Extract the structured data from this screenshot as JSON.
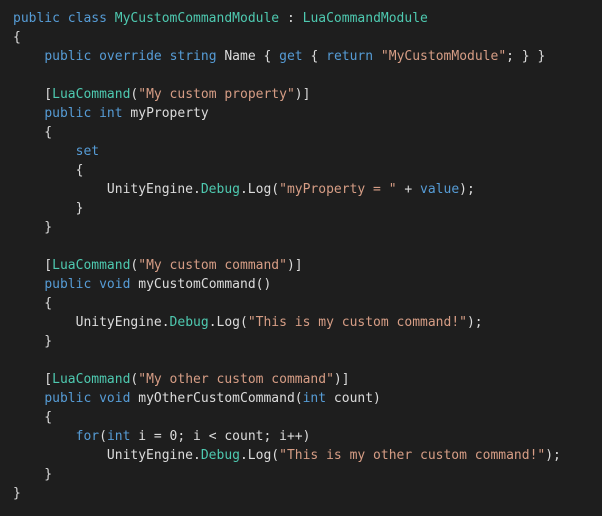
{
  "colors": {
    "background": "#1e1e1e",
    "plain": "#dcdcdc",
    "keyword": "#569cd6",
    "type": "#4ec9b0",
    "string": "#d69d85"
  },
  "code_lines": [
    [
      {
        "t": "public",
        "c": "kw"
      },
      {
        "t": " ",
        "c": "pl"
      },
      {
        "t": "class",
        "c": "kw"
      },
      {
        "t": " ",
        "c": "pl"
      },
      {
        "t": "MyCustomCommandModule",
        "c": "ty"
      },
      {
        "t": " : ",
        "c": "pl"
      },
      {
        "t": "LuaCommandModule",
        "c": "ty"
      }
    ],
    [
      {
        "t": "{",
        "c": "pl"
      }
    ],
    [
      {
        "t": "    ",
        "c": "pl"
      },
      {
        "t": "public",
        "c": "kw"
      },
      {
        "t": " ",
        "c": "pl"
      },
      {
        "t": "override",
        "c": "kw"
      },
      {
        "t": " ",
        "c": "pl"
      },
      {
        "t": "string",
        "c": "kw"
      },
      {
        "t": " Name { ",
        "c": "pl"
      },
      {
        "t": "get",
        "c": "kw"
      },
      {
        "t": " { ",
        "c": "pl"
      },
      {
        "t": "return",
        "c": "kw"
      },
      {
        "t": " ",
        "c": "pl"
      },
      {
        "t": "\"MyCustomModule\"",
        "c": "st"
      },
      {
        "t": "; } }",
        "c": "pl"
      }
    ],
    [],
    [
      {
        "t": "    [",
        "c": "pl"
      },
      {
        "t": "LuaCommand",
        "c": "ty"
      },
      {
        "t": "(",
        "c": "pl"
      },
      {
        "t": "\"My custom property\"",
        "c": "st"
      },
      {
        "t": ")]",
        "c": "pl"
      }
    ],
    [
      {
        "t": "    ",
        "c": "pl"
      },
      {
        "t": "public",
        "c": "kw"
      },
      {
        "t": " ",
        "c": "pl"
      },
      {
        "t": "int",
        "c": "kw"
      },
      {
        "t": " myProperty",
        "c": "pl"
      }
    ],
    [
      {
        "t": "    {",
        "c": "pl"
      }
    ],
    [
      {
        "t": "        ",
        "c": "pl"
      },
      {
        "t": "set",
        "c": "kw"
      }
    ],
    [
      {
        "t": "        {",
        "c": "pl"
      }
    ],
    [
      {
        "t": "            UnityEngine.",
        "c": "pl"
      },
      {
        "t": "Debug",
        "c": "ty"
      },
      {
        "t": ".Log(",
        "c": "pl"
      },
      {
        "t": "\"myProperty = \"",
        "c": "st"
      },
      {
        "t": " + ",
        "c": "pl"
      },
      {
        "t": "value",
        "c": "kw"
      },
      {
        "t": ");",
        "c": "pl"
      }
    ],
    [
      {
        "t": "        }",
        "c": "pl"
      }
    ],
    [
      {
        "t": "    }",
        "c": "pl"
      }
    ],
    [],
    [
      {
        "t": "    [",
        "c": "pl"
      },
      {
        "t": "LuaCommand",
        "c": "ty"
      },
      {
        "t": "(",
        "c": "pl"
      },
      {
        "t": "\"My custom command\"",
        "c": "st"
      },
      {
        "t": ")]",
        "c": "pl"
      }
    ],
    [
      {
        "t": "    ",
        "c": "pl"
      },
      {
        "t": "public",
        "c": "kw"
      },
      {
        "t": " ",
        "c": "pl"
      },
      {
        "t": "void",
        "c": "kw"
      },
      {
        "t": " myCustomCommand()",
        "c": "pl"
      }
    ],
    [
      {
        "t": "    {",
        "c": "pl"
      }
    ],
    [
      {
        "t": "        UnityEngine.",
        "c": "pl"
      },
      {
        "t": "Debug",
        "c": "ty"
      },
      {
        "t": ".Log(",
        "c": "pl"
      },
      {
        "t": "\"This is my custom command!\"",
        "c": "st"
      },
      {
        "t": ");",
        "c": "pl"
      }
    ],
    [
      {
        "t": "    }",
        "c": "pl"
      }
    ],
    [],
    [
      {
        "t": "    [",
        "c": "pl"
      },
      {
        "t": "LuaCommand",
        "c": "ty"
      },
      {
        "t": "(",
        "c": "pl"
      },
      {
        "t": "\"My other custom command\"",
        "c": "st"
      },
      {
        "t": ")]",
        "c": "pl"
      }
    ],
    [
      {
        "t": "    ",
        "c": "pl"
      },
      {
        "t": "public",
        "c": "kw"
      },
      {
        "t": " ",
        "c": "pl"
      },
      {
        "t": "void",
        "c": "kw"
      },
      {
        "t": " myOtherCustomCommand(",
        "c": "pl"
      },
      {
        "t": "int",
        "c": "kw"
      },
      {
        "t": " count)",
        "c": "pl"
      }
    ],
    [
      {
        "t": "    {",
        "c": "pl"
      }
    ],
    [
      {
        "t": "        ",
        "c": "pl"
      },
      {
        "t": "for",
        "c": "kw"
      },
      {
        "t": "(",
        "c": "pl"
      },
      {
        "t": "int",
        "c": "kw"
      },
      {
        "t": " i = 0; i < count; i++)",
        "c": "pl"
      }
    ],
    [
      {
        "t": "            UnityEngine.",
        "c": "pl"
      },
      {
        "t": "Debug",
        "c": "ty"
      },
      {
        "t": ".Log(",
        "c": "pl"
      },
      {
        "t": "\"This is my other custom command!\"",
        "c": "st"
      },
      {
        "t": ");",
        "c": "pl"
      }
    ],
    [
      {
        "t": "    }",
        "c": "pl"
      }
    ],
    [
      {
        "t": "}",
        "c": "pl"
      }
    ]
  ]
}
